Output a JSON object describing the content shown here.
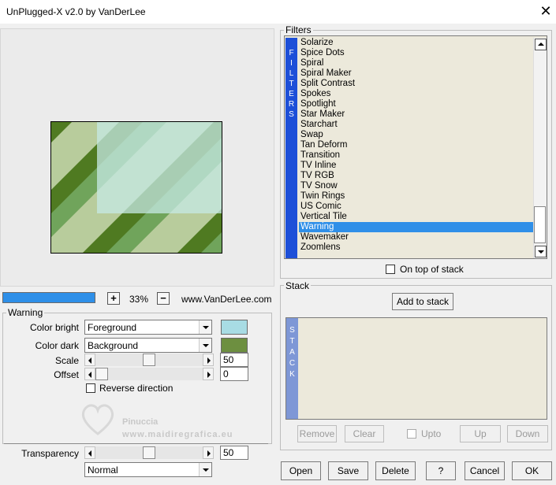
{
  "window": {
    "title": "UnPlugged-X v2.0 by VanDerLee",
    "close_glyph": "✕"
  },
  "preview": {
    "zoom_plus": "+",
    "zoom_minus": "−",
    "zoom": "33%",
    "website": "www.VanDerLee.com",
    "progress": 1.0,
    "colors": {
      "dark_stripe": "#4f7a21",
      "light_stripe": "#b8cc9c",
      "mid_stripe": "#8cc68c",
      "highlight": "#c6eae4"
    }
  },
  "warning_panel": {
    "title": "Warning",
    "color_bright": {
      "label": "Color bright",
      "value": "Foreground",
      "swatch": "#a8dce4"
    },
    "color_dark": {
      "label": "Color dark",
      "value": "Background",
      "swatch": "#6d8f40"
    },
    "scale": {
      "label": "Scale",
      "value": "50",
      "level": 0.5
    },
    "offset": {
      "label": "Offset",
      "value": "0",
      "level": 0.0
    },
    "reverse_direction": {
      "label": "Reverse direction",
      "checked": false
    },
    "transparency": {
      "label": "Transparency",
      "value": "50",
      "level": 0.5
    },
    "blend_mode": {
      "value": "Normal"
    }
  },
  "watermark": {
    "line1": "Pinuccia",
    "line2": "www.maidiregrafica.eu"
  },
  "filters": {
    "title": "Filters",
    "strip_letters": [
      "F",
      "I",
      "L",
      "T",
      "E",
      "R",
      "S"
    ],
    "items": [
      "Solarize",
      "Spice Dots",
      "Spiral",
      "Spiral Maker",
      "Split Contrast",
      "Spokes",
      "Spotlight",
      "Star Maker",
      "Starchart",
      "Swap",
      "Tan Deform",
      "Transition",
      "TV Inline",
      "TV RGB",
      "TV Snow",
      "Twin Rings",
      "US Comic",
      "Vertical Tile",
      "Warning",
      "Wavemaker",
      "Zoomlens"
    ],
    "selected_index": 18,
    "on_top_label": "On top of stack",
    "on_top_checked": false
  },
  "stack": {
    "title": "Stack",
    "add_label": "Add to stack",
    "strip_letters": [
      "S",
      "T",
      "A",
      "C",
      "K"
    ],
    "remove_label": "Remove",
    "clear_label": "Clear",
    "upto_label": "Upto",
    "up_label": "Up",
    "down_label": "Down"
  },
  "footer": {
    "open": "Open",
    "save": "Save",
    "delete": "Delete",
    "help": "?",
    "cancel": "Cancel",
    "ok": "OK"
  }
}
